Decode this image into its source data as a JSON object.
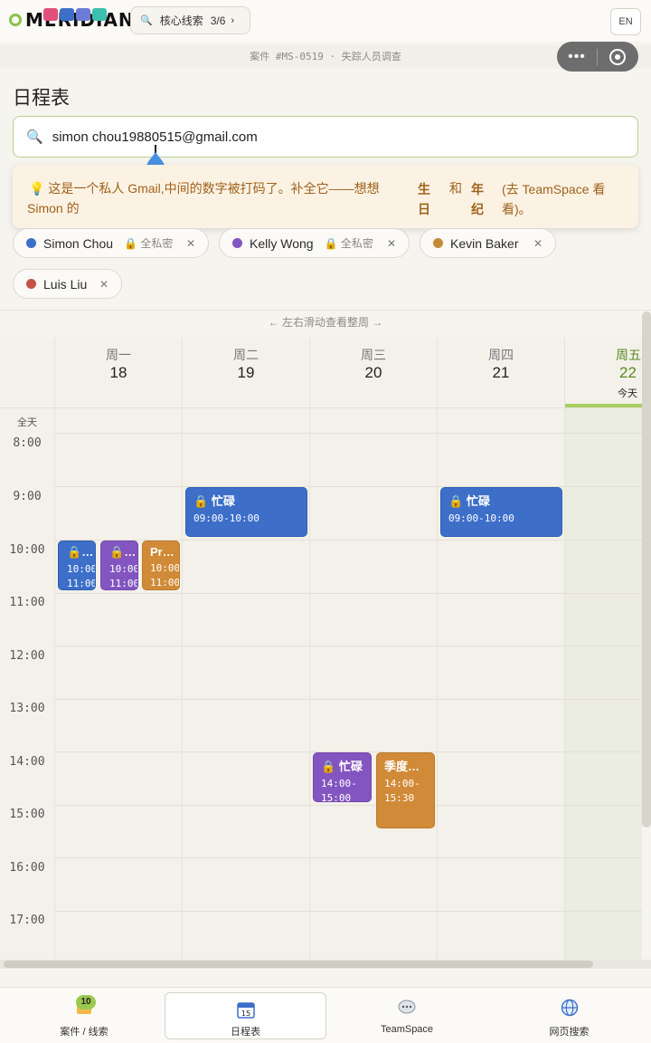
{
  "topbar": {
    "brand": "MERIDIAN",
    "clue_chip": {
      "label": "核心线索",
      "progress": "3/6",
      "arrow": "›"
    },
    "lang_button": "EN",
    "case_line": "案件 #MS-0519 · 失踪人员调查"
  },
  "page": {
    "title": "日程表"
  },
  "search": {
    "value": "simon chou19880515@gmail.com"
  },
  "hint": {
    "line1": "这是一个私人 Gmail,中间的数字被打码了。补全它——想想",
    "line2": "Simon 的",
    "bold1": "生日",
    "and": "和",
    "bold2": "年纪",
    "tail": "(去 TeamSpace 看看)。"
  },
  "people": [
    {
      "name": "Simon Chou",
      "privacy": "全私密",
      "color": "#3d6fc9"
    },
    {
      "name": "Kelly Wong",
      "privacy": "全私密",
      "color": "#8355c0"
    },
    {
      "name": "Kevin Baker",
      "privacy": "",
      "color": "#c48a3a"
    },
    {
      "name": "Luis Liu",
      "privacy": "",
      "color": "#c4534a"
    }
  ],
  "swipe_hint": "← 左右滑动查看整周 →",
  "calendar": {
    "days": [
      {
        "name": "周一",
        "date": "18"
      },
      {
        "name": "周二",
        "date": "19"
      },
      {
        "name": "周三",
        "date": "20"
      },
      {
        "name": "周四",
        "date": "21"
      },
      {
        "name": "周五",
        "date": "22",
        "today_label": "今天"
      }
    ],
    "allday_label": "全天",
    "times": [
      "8:00",
      "9:00",
      "10:00",
      "11:00",
      "12:00",
      "13:00",
      "14:00",
      "15:00",
      "16:00",
      "17:00"
    ],
    "events": [
      {
        "title": "忙碌",
        "time": "09:00-10:00",
        "color": "blue",
        "locked": true
      },
      {
        "title": "忙碌",
        "time": "09:00-10:00",
        "color": "blue",
        "locked": true
      },
      {
        "title": "…",
        "time_start": "10:00",
        "time_end": "11:00",
        "color": "blue",
        "locked": true
      },
      {
        "title": "…",
        "time_start": "10:00",
        "time_end": "11:00",
        "color": "purple",
        "locked": true
      },
      {
        "title": "Pr…",
        "time_start": "10:00",
        "time_end": "11:00",
        "color": "orange",
        "locked": false
      },
      {
        "title": "忙碌",
        "time_start": "14:00-",
        "time_end": "15:00",
        "color": "purple",
        "locked": true
      },
      {
        "title": "季度…",
        "time_start": "14:00-",
        "time_end": "15:30",
        "color": "orange",
        "locked": false
      }
    ]
  },
  "bottom_nav": [
    {
      "label": "案件 / 线索",
      "badge": "10"
    },
    {
      "label": "日程表",
      "icon_text": "15"
    },
    {
      "label": "TeamSpace"
    },
    {
      "label": "网页搜索"
    }
  ]
}
